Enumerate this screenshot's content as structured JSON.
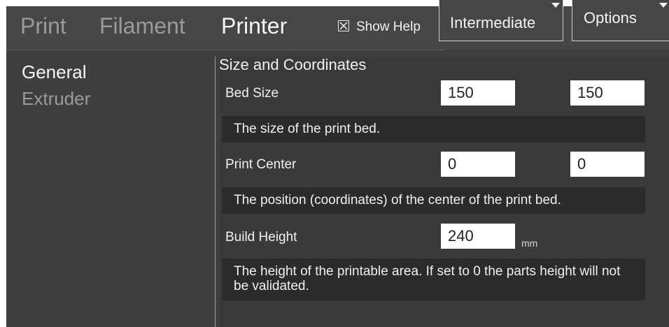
{
  "tabs": [
    {
      "label": "Print",
      "active": false
    },
    {
      "label": "Filament",
      "active": false
    },
    {
      "label": "Printer",
      "active": true
    }
  ],
  "show_help": {
    "label": "Show Help",
    "checked": true,
    "icon": "checkbox-x-icon"
  },
  "level_dropdown": {
    "value": "Intermediate"
  },
  "options_dropdown": {
    "label": "Options"
  },
  "nav": {
    "items": [
      {
        "label": "General",
        "active": true
      },
      {
        "label": "Extruder",
        "active": false
      }
    ]
  },
  "section": {
    "title": "Size and Coordinates",
    "fields": {
      "bed_size": {
        "label": "Bed Size",
        "x": "150",
        "y": "150",
        "help": "The size of the print bed."
      },
      "print_center": {
        "label": "Print Center",
        "x": "0",
        "y": "0",
        "help": "The position (coordinates) of the center of the print bed."
      },
      "build_height": {
        "label": "Build Height",
        "value": "240",
        "unit": "mm",
        "help": "The height of the printable area. If set to 0 the parts height will not be validated."
      }
    }
  },
  "colors": {
    "background": "#3f3f3f",
    "panel": "#3a3a3a",
    "help_box": "#2b2b2b",
    "active_text": "#f4f4f4",
    "inactive_text": "#9a9a9a"
  }
}
